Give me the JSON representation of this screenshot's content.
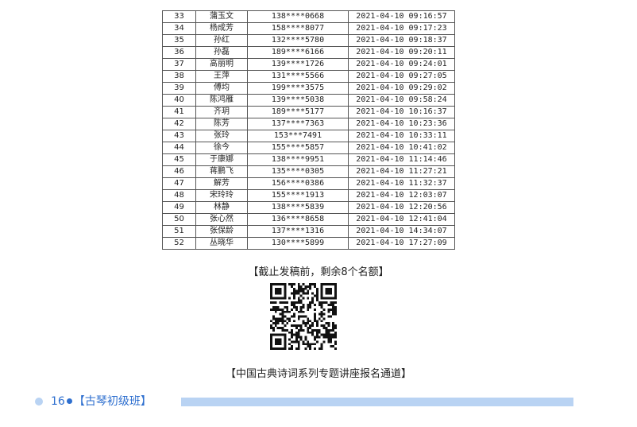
{
  "registrants": [
    {
      "no": "33",
      "name": "蒲玉文",
      "phone": "138****0668",
      "time": "2021-04-10 09:16:57"
    },
    {
      "no": "34",
      "name": "杨成芳",
      "phone": "158****8077",
      "time": "2021-04-10 09:17:23"
    },
    {
      "no": "35",
      "name": "孙红",
      "phone": "132****5780",
      "time": "2021-04-10 09:18:37"
    },
    {
      "no": "36",
      "name": "孙磊",
      "phone": "189****6166",
      "time": "2021-04-10 09:20:11"
    },
    {
      "no": "37",
      "name": "高丽明",
      "phone": "139****1726",
      "time": "2021-04-10 09:24:01"
    },
    {
      "no": "38",
      "name": "王萍",
      "phone": "131****5566",
      "time": "2021-04-10 09:27:05"
    },
    {
      "no": "39",
      "name": "傅均",
      "phone": "199****3575",
      "time": "2021-04-10 09:29:02"
    },
    {
      "no": "40",
      "name": "陈鸿雁",
      "phone": "139****5038",
      "time": "2021-04-10 09:58:24"
    },
    {
      "no": "41",
      "name": "齐玥",
      "phone": "189****5177",
      "time": "2021-04-10 10:16:37"
    },
    {
      "no": "42",
      "name": "陈芳",
      "phone": "137****7363",
      "time": "2021-04-10 10:23:36"
    },
    {
      "no": "43",
      "name": "张玲",
      "phone": "153***7491",
      "time": "2021-04-10 10:33:11"
    },
    {
      "no": "44",
      "name": "徐今",
      "phone": "155****5857",
      "time": "2021-04-10 10:41:02"
    },
    {
      "no": "45",
      "name": "于康娜",
      "phone": "138****9951",
      "time": "2021-04-10 11:14:46"
    },
    {
      "no": "46",
      "name": "蒋鹏飞",
      "phone": "135****0305",
      "time": "2021-04-10 11:27:21"
    },
    {
      "no": "47",
      "name": "解芳",
      "phone": "156****0386",
      "time": "2021-04-10 11:32:37"
    },
    {
      "no": "48",
      "name": "宋玲玲",
      "phone": "155****1913",
      "time": "2021-04-10 12:03:07"
    },
    {
      "no": "49",
      "name": "林静",
      "phone": "138****5839",
      "time": "2021-04-10 12:20:56"
    },
    {
      "no": "50",
      "name": "张心然",
      "phone": "136****8658",
      "time": "2021-04-10 12:41:04"
    },
    {
      "no": "51",
      "name": "张保龄",
      "phone": "137****1316",
      "time": "2021-04-10 14:34:07"
    },
    {
      "no": "52",
      "name": "丛晓华",
      "phone": "130****5899",
      "time": "2021-04-10 17:27:09"
    }
  ],
  "quota_note": "【截止发稿前，剩余8个名额】",
  "channel_title": "【中国古典诗词系列专题讲座报名通道】",
  "footer": {
    "page_number": "16",
    "section_name": "【古琴初级班】"
  },
  "colors": {
    "accent": "#2e6fcf",
    "accent_light": "#b9d3f3",
    "table_border": "#555555"
  },
  "icons": {
    "qr": "qr-code-icon"
  }
}
